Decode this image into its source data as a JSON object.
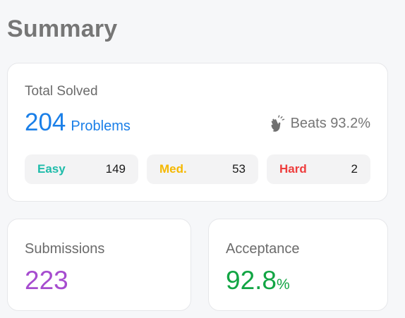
{
  "page": {
    "title": "Summary"
  },
  "total_solved": {
    "label": "Total Solved",
    "count": "204",
    "unit": "Problems",
    "beats_icon": "clapping-hands-icon",
    "beats_text": "Beats 93.2%"
  },
  "difficulty": [
    {
      "label": "Easy",
      "count": "149",
      "color": "#1fbcaa"
    },
    {
      "label": "Med.",
      "count": "53",
      "color": "#f5b800"
    },
    {
      "label": "Hard",
      "count": "2",
      "color": "#ee3d3d"
    }
  ],
  "submissions": {
    "label": "Submissions",
    "value": "223",
    "color": "#a64ccf"
  },
  "acceptance": {
    "label": "Acceptance",
    "value": "92.8",
    "unit": "%",
    "color": "#12a544"
  }
}
